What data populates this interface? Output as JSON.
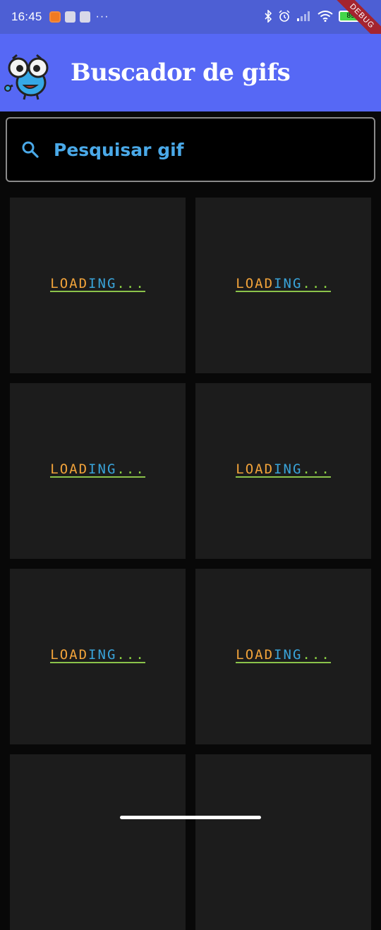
{
  "status_bar": {
    "time": "16:45",
    "battery": "89",
    "more": "···"
  },
  "debug_ribbon": "DEBUG",
  "app_bar": {
    "title": "Buscador de gifs",
    "logo": "binoculars-mascot-icon"
  },
  "search": {
    "placeholder": "Pesquisar gif",
    "icon": "search-icon"
  },
  "colors": {
    "app_bar": "#5668f5",
    "status_bar": "#4d5fd4",
    "accent": "#4aa9e8",
    "cell_bg": "#1c1c1c",
    "page_bg": "#080808"
  },
  "gifs": [
    {
      "label": "LOADING..."
    },
    {
      "label": "LOADING..."
    },
    {
      "label": "LOADING..."
    },
    {
      "label": "LOADING..."
    },
    {
      "label": "LOADING..."
    },
    {
      "label": "LOADING..."
    },
    {
      "label": ""
    },
    {
      "label": ""
    }
  ]
}
